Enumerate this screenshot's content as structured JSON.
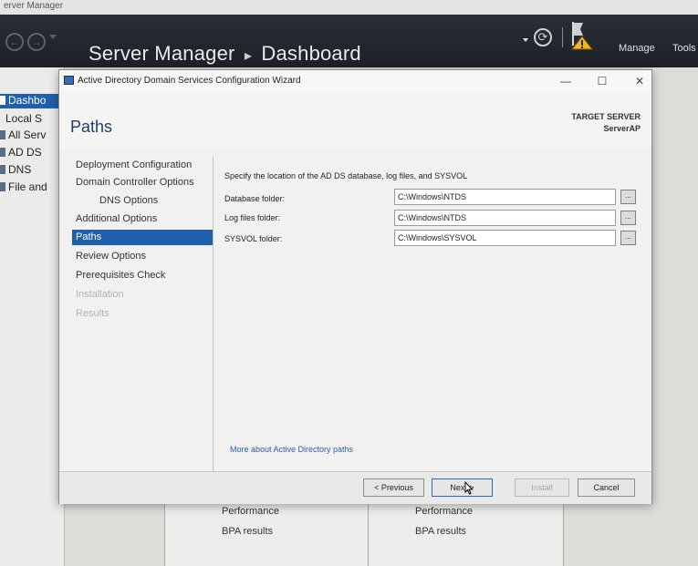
{
  "outer_window": {
    "title": "erver Manager",
    "header": {
      "title": "Server Manager",
      "separator": "▸",
      "breadcrumb": "Dashboard",
      "manage": "Manage",
      "tools": "Tools",
      "back_glyph": "←",
      "forward_glyph": "→",
      "refresh_glyph": "⟳",
      "flag_icon": "notifications-flag-icon",
      "warning_icon": "warning-triangle-icon"
    },
    "sidebar": {
      "items": [
        {
          "label": "Dashbo",
          "icon": "dashboard-icon"
        },
        {
          "label": "Local S",
          "icon": "server-icon"
        },
        {
          "label": "All Serv",
          "icon": "servers-icon"
        },
        {
          "label": "AD DS",
          "icon": "adds-icon"
        },
        {
          "label": "DNS",
          "icon": "dns-icon"
        },
        {
          "label": "File and",
          "icon": "file-services-icon"
        }
      ]
    },
    "tiles": [
      {
        "performance": "Performance",
        "bpa": "BPA results"
      },
      {
        "performance": "Performance",
        "bpa": "BPA results"
      }
    ]
  },
  "wizard": {
    "title": "Active Directory Domain Services Configuration Wizard",
    "icon": "adds-wizard-icon",
    "window_buttons": {
      "minimize": "—",
      "maximize": "☐",
      "close": "✕"
    },
    "page_heading": "Paths",
    "target_server_label": "TARGET SERVER",
    "target_server_name": "ServerAP",
    "nav": [
      {
        "label": "Deployment Configuration",
        "state": "normal"
      },
      {
        "label": "Domain Controller Options",
        "state": "normal"
      },
      {
        "label": "DNS Options",
        "state": "sub"
      },
      {
        "label": "Additional Options",
        "state": "normal"
      },
      {
        "label": "Paths",
        "state": "active"
      },
      {
        "label": "Review Options",
        "state": "normal"
      },
      {
        "label": "Prerequisites Check",
        "state": "normal"
      },
      {
        "label": "Installation",
        "state": "disabled"
      },
      {
        "label": "Results",
        "state": "disabled"
      }
    ],
    "intro": "Specify the location of the AD DS database, log files, and SYSVOL",
    "fields": [
      {
        "label": "Database folder:",
        "value": "C:\\Windows\\NTDS",
        "browse": "..."
      },
      {
        "label": "Log files folder:",
        "value": "C:\\Windows\\NTDS",
        "browse": "..."
      },
      {
        "label": "SYSVOL folder:",
        "value": "C:\\Windows\\SYSVOL",
        "browse": "..."
      }
    ],
    "more_link": "More about Active Directory paths",
    "buttons": {
      "previous": "< Previous",
      "next": "Next >",
      "install": "Install",
      "cancel": "Cancel"
    }
  }
}
